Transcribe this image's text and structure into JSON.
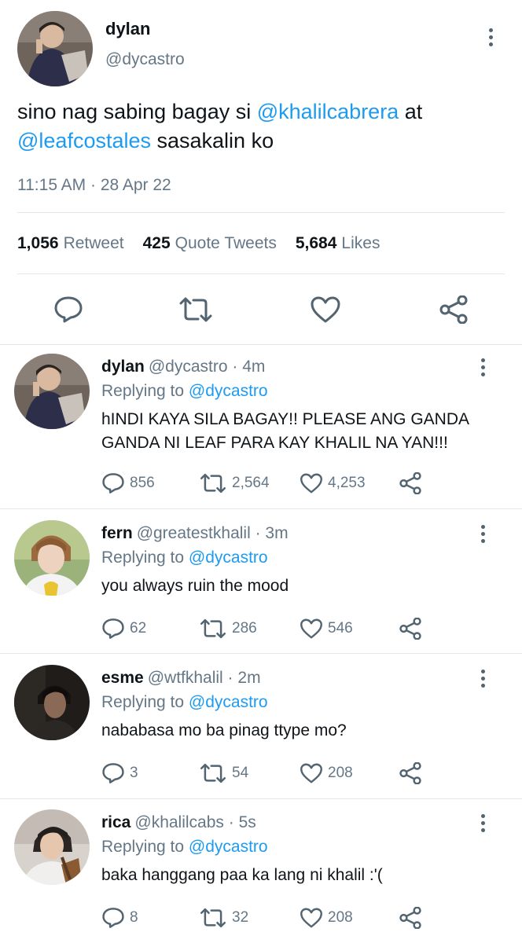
{
  "tweet": {
    "author_name": "dylan",
    "author_handle": "@dycastro",
    "text_part1": "sino nag sabing bagay si ",
    "mention1": "@khalilcabrera",
    "text_part2": " at ",
    "mention2": "@leafcostales",
    "text_part3": " sasakalin ko",
    "timestamp": "11:15 AM · 28 Apr 22",
    "retweets_count": "1,056",
    "retweets_label": "Retweet",
    "quotes_count": "425",
    "quotes_label": "Quote Tweets",
    "likes_count": "5,684",
    "likes_label": "Likes"
  },
  "replies": [
    {
      "name": "dylan",
      "handle_time": "@dycastro · 4m",
      "replying_label": "Replying to",
      "replying_to": "@dycastro",
      "text": "hINDI KAYA SILA BAGAY!! PLEASE ANG GANDA GANDA NI LEAF PARA KAY KHALIL NA YAN!!!",
      "replies": "856",
      "retweets": "2,564",
      "likes": "4,253"
    },
    {
      "name": "fern",
      "handle_time": "@greatestkhalil · 3m",
      "replying_label": "Replying to",
      "replying_to": "@dycastro",
      "text": "you always ruin the mood",
      "replies": "62",
      "retweets": "286",
      "likes": "546"
    },
    {
      "name": "esme",
      "handle_time": "@wtfkhalil · 2m",
      "replying_label": "Replying to",
      "replying_to": "@dycastro",
      "text": "nababasa mo ba pinag ttype mo?",
      "replies": "3",
      "retweets": "54",
      "likes": "208"
    },
    {
      "name": "rica",
      "handle_time": "@khalilcabs · 5s",
      "replying_label": "Replying to",
      "replying_to": "@dycastro",
      "text": "baka hanggang paa ka lang ni khalil :'(",
      "replies": "8",
      "retweets": "32",
      "likes": "208"
    }
  ],
  "colors": {
    "link": "#1d9bf0",
    "muted": "#657786",
    "text": "#0f1419",
    "divider": "#e1e8ed"
  },
  "icons": [
    "kebab-menu-icon",
    "reply-icon",
    "retweet-icon",
    "like-icon",
    "share-icon"
  ]
}
